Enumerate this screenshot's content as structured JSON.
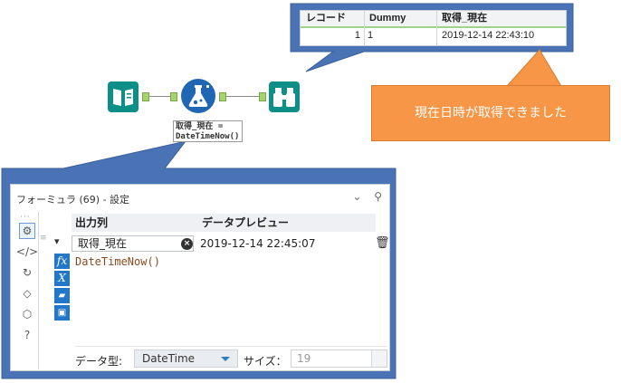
{
  "result_grid": {
    "headers": [
      "レコード",
      "Dummy",
      "取得_現在"
    ],
    "row": {
      "record": "1",
      "dummy": "1",
      "value": "2019-12-14 22:43:10"
    }
  },
  "workflow": {
    "formula_annotation": "取得_現在 =\nDateTimeNow()"
  },
  "note": {
    "text": "現在日時が取得できました"
  },
  "panel": {
    "title": "フォーミュラ (69) - 設定",
    "columns": {
      "output": "出力列",
      "preview": "データプレビュー"
    },
    "row": {
      "field": "取得_現在",
      "preview": "2019-12-14 22:45:07"
    },
    "expression": "DateTimeNow()",
    "bottom": {
      "type_label": "データ型:",
      "type_value": "DateTime",
      "size_label": "サイズ：",
      "size_value": "19"
    }
  },
  "colors": {
    "callout_blue": "#4a73b5",
    "note_orange": "#f79646",
    "tool_teal": "#0b8f86",
    "formula_blue": "#1f66b3"
  }
}
